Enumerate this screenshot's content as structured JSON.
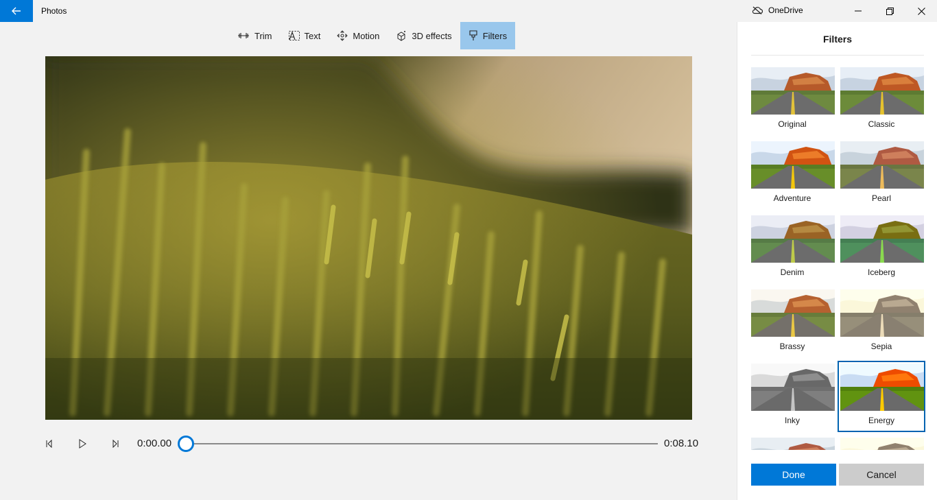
{
  "app": {
    "title": "Photos"
  },
  "onedrive": {
    "label": "OneDrive"
  },
  "toolbar": {
    "items": [
      {
        "label": "Trim",
        "icon": "trim-icon"
      },
      {
        "label": "Text",
        "icon": "text-icon"
      },
      {
        "label": "Motion",
        "icon": "motion-icon"
      },
      {
        "label": "3D effects",
        "icon": "3d-effects-icon"
      },
      {
        "label": "Filters",
        "icon": "filters-icon",
        "active": true
      }
    ]
  },
  "playback": {
    "current_time": "0:00.00",
    "duration": "0:08.10",
    "progress": 0
  },
  "panel": {
    "title": "Filters",
    "filters": [
      {
        "label": "Original"
      },
      {
        "label": "Classic"
      },
      {
        "label": "Adventure"
      },
      {
        "label": "Pearl"
      },
      {
        "label": "Denim"
      },
      {
        "label": "Iceberg"
      },
      {
        "label": "Brassy"
      },
      {
        "label": "Sepia"
      },
      {
        "label": "Inky"
      },
      {
        "label": "Energy",
        "selected": true
      }
    ],
    "done_label": "Done",
    "cancel_label": "Cancel"
  },
  "colors": {
    "accent": "#0078d7",
    "active_tool": "#99c7ec"
  }
}
